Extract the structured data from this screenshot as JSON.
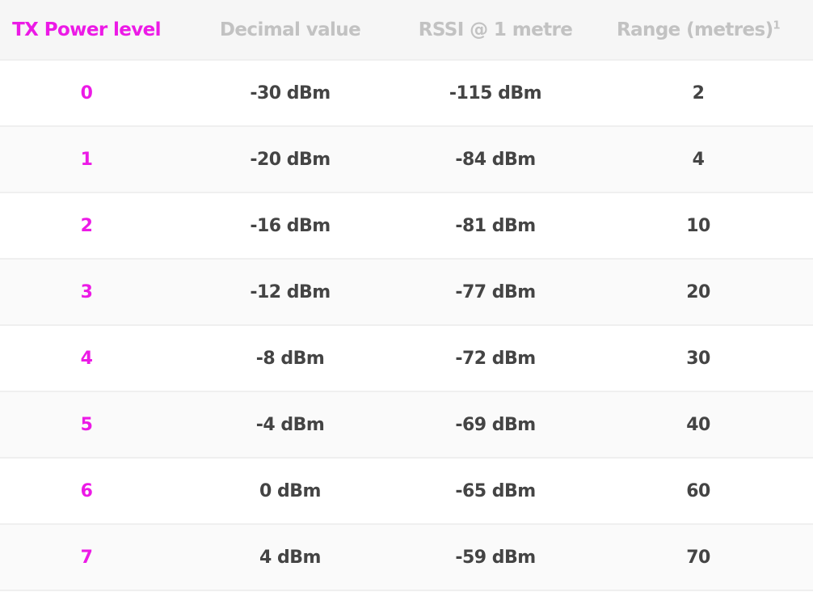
{
  "table": {
    "headers": {
      "tx_power_level": "TX Power level",
      "decimal_value": "Decimal value",
      "rssi": "RSSI @ 1 metre",
      "range": "Range (metres)",
      "range_footnote": "1"
    },
    "rows": [
      {
        "level": "0",
        "decimal": "-30 dBm",
        "rssi": "-115 dBm",
        "range": "2"
      },
      {
        "level": "1",
        "decimal": "-20 dBm",
        "rssi": "-84 dBm",
        "range": "4"
      },
      {
        "level": "2",
        "decimal": "-16 dBm",
        "rssi": "-81 dBm",
        "range": "10"
      },
      {
        "level": "3",
        "decimal": "-12 dBm",
        "rssi": "-77 dBm",
        "range": "20"
      },
      {
        "level": "4",
        "decimal": "-8 dBm",
        "rssi": "-72 dBm",
        "range": "30"
      },
      {
        "level": "5",
        "decimal": "-4 dBm",
        "rssi": "-69 dBm",
        "range": "40"
      },
      {
        "level": "6",
        "decimal": "0 dBm",
        "rssi": "-65 dBm",
        "range": "60"
      },
      {
        "level": "7",
        "decimal": "4 dBm",
        "rssi": "-59 dBm",
        "range": "70"
      }
    ]
  },
  "colors": {
    "accent_magenta": "#ec1ae6",
    "header_text": "#c2c2c2",
    "body_text": "#444444",
    "header_background": "#f6f6f6"
  }
}
